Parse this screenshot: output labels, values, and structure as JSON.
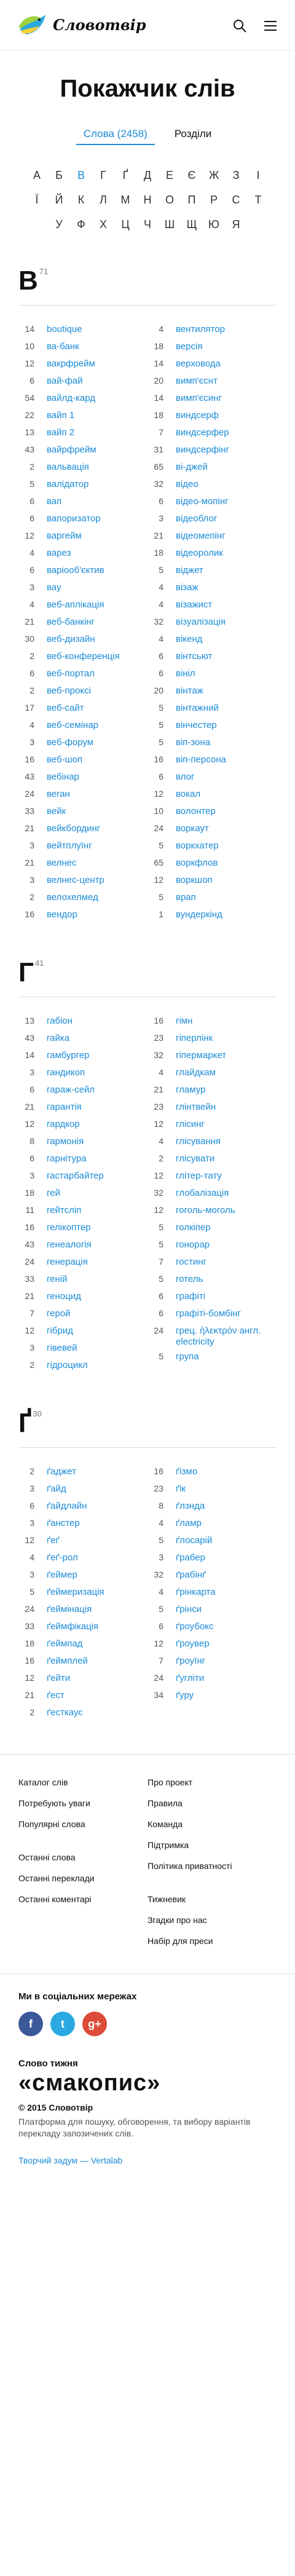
{
  "header": {
    "logo_text": "Словотвір"
  },
  "page_title": "Покажчик слів",
  "tabs": [
    {
      "label": "Слова (2458)",
      "active": true
    },
    {
      "label": "Розділи",
      "active": false
    }
  ],
  "alphabet": [
    "А",
    "Б",
    "В",
    "Г",
    "Ґ",
    "Д",
    "Е",
    "Є",
    "Ж",
    "З",
    "І",
    "Ї",
    "Й",
    "К",
    "Л",
    "М",
    "Н",
    "О",
    "П",
    "Р",
    "С",
    "Т",
    "У",
    "Ф",
    "Х",
    "Ц",
    "Ч",
    "Ш",
    "Щ",
    "Ю",
    "Я"
  ],
  "current_letter": "В",
  "sections": [
    {
      "letter": "В",
      "count": "71",
      "left": [
        {
          "n": "14",
          "w": "boutique"
        },
        {
          "n": "10",
          "w": "ва-банк"
        },
        {
          "n": "12",
          "w": "вакрфрейм"
        },
        {
          "n": "6",
          "w": "вай-фай"
        },
        {
          "n": "54",
          "w": "вайлд-кард"
        },
        {
          "n": "22",
          "w": "вайп 1"
        },
        {
          "n": "13",
          "w": "вайп 2"
        },
        {
          "n": "43",
          "w": "вайрфрейм"
        },
        {
          "n": "2",
          "w": "вальвація"
        },
        {
          "n": "5",
          "w": "валідатор"
        },
        {
          "n": "6",
          "w": "вап"
        },
        {
          "n": "6",
          "w": "вапоризатор"
        },
        {
          "n": "12",
          "w": "варгейм"
        },
        {
          "n": "4",
          "w": "варез"
        },
        {
          "n": "6",
          "w": "варіооб'єктив"
        },
        {
          "n": "3",
          "w": "вау"
        },
        {
          "n": "4",
          "w": "веб-аплікація"
        },
        {
          "n": "21",
          "w": "веб-банкінг"
        },
        {
          "n": "30",
          "w": "веб-дизайн"
        },
        {
          "n": "2",
          "w": "веб-конференція"
        },
        {
          "n": "6",
          "w": "веб-портал"
        },
        {
          "n": "2",
          "w": "веб-проксі"
        },
        {
          "n": "17",
          "w": "веб-сайт"
        },
        {
          "n": "4",
          "w": "веб-семінар"
        },
        {
          "n": "3",
          "w": "веб-форум"
        },
        {
          "n": "16",
          "w": "веб-шоп"
        },
        {
          "n": "43",
          "w": "вебінар"
        },
        {
          "n": "24",
          "w": "веган"
        },
        {
          "n": "33",
          "w": "вейк"
        },
        {
          "n": "21",
          "w": "вейкбординг"
        },
        {
          "n": "3",
          "w": "вейтплуїнг"
        },
        {
          "n": "21",
          "w": "велнес"
        },
        {
          "n": "3",
          "w": "велнес-центр"
        },
        {
          "n": "2",
          "w": "велохелмед"
        },
        {
          "n": "16",
          "w": "вендор"
        }
      ],
      "right": [
        {
          "n": "4",
          "w": "вентилятор"
        },
        {
          "n": "18",
          "w": "версія"
        },
        {
          "n": "14",
          "w": "верховода"
        },
        {
          "n": "20",
          "w": "вимп'єснт"
        },
        {
          "n": "14",
          "w": "вимп'єсинг"
        },
        {
          "n": "18",
          "w": "виндсерф"
        },
        {
          "n": "7",
          "w": "виндсерфер"
        },
        {
          "n": "31",
          "w": "виндсерфінг"
        },
        {
          "n": "65",
          "w": "ві-джей"
        },
        {
          "n": "32",
          "w": "відео"
        },
        {
          "n": "6",
          "w": "відео-мопінг"
        },
        {
          "n": "3",
          "w": "відеоблог"
        },
        {
          "n": "21",
          "w": "відеомепінг"
        },
        {
          "n": "18",
          "w": "відеоролик"
        },
        {
          "n": "5",
          "w": "віджет"
        },
        {
          "n": "4",
          "w": "візаж"
        },
        {
          "n": "4",
          "w": "візажист"
        },
        {
          "n": "32",
          "w": "візуалізація"
        },
        {
          "n": "4",
          "w": "вікенд"
        },
        {
          "n": "6",
          "w": "вінтсьют"
        },
        {
          "n": "6",
          "w": "вініл"
        },
        {
          "n": "20",
          "w": "вінтаж"
        },
        {
          "n": "5",
          "w": "вінтажний"
        },
        {
          "n": "5",
          "w": "вінчестер"
        },
        {
          "n": "5",
          "w": "віп-зона"
        },
        {
          "n": "16",
          "w": "віп-персона"
        },
        {
          "n": "6",
          "w": "влог"
        },
        {
          "n": "12",
          "w": "вокал"
        },
        {
          "n": "10",
          "w": "волонтер"
        },
        {
          "n": "24",
          "w": "воркаут"
        },
        {
          "n": "5",
          "w": "воркхатер"
        },
        {
          "n": "65",
          "w": "воркфлов"
        },
        {
          "n": "12",
          "w": "воркшоп"
        },
        {
          "n": "5",
          "w": "врап"
        },
        {
          "n": "1",
          "w": "вундеркінд"
        }
      ]
    },
    {
      "letter": "Г",
      "count": "41",
      "left": [
        {
          "n": "13",
          "w": "габіон"
        },
        {
          "n": "43",
          "w": "гайка"
        },
        {
          "n": "14",
          "w": "гамбургер"
        },
        {
          "n": "3",
          "w": "гандикоп"
        },
        {
          "n": "6",
          "w": "гараж-сейл"
        },
        {
          "n": "21",
          "w": "гарантія"
        },
        {
          "n": "12",
          "w": "гардкор"
        },
        {
          "n": "8",
          "w": "гармонія"
        },
        {
          "n": "6",
          "w": "гарнітура"
        },
        {
          "n": "3",
          "w": "гастарбайтер"
        },
        {
          "n": "18",
          "w": "гей"
        },
        {
          "n": "11",
          "w": "гейтсліп"
        },
        {
          "n": "16",
          "w": "гелікоптер"
        },
        {
          "n": "43",
          "w": "генеалогія"
        },
        {
          "n": "24",
          "w": "генерація"
        },
        {
          "n": "33",
          "w": "геній"
        },
        {
          "n": "21",
          "w": "геноцид"
        },
        {
          "n": "7",
          "w": "герой"
        },
        {
          "n": "12",
          "w": "гібрид"
        },
        {
          "n": "3",
          "w": "гівевей"
        },
        {
          "n": "2",
          "w": "гідроцикл"
        }
      ],
      "right": [
        {
          "n": "16",
          "w": "гімн"
        },
        {
          "n": "23",
          "w": "гіперлінк"
        },
        {
          "n": "32",
          "w": "гіпермаркет"
        },
        {
          "n": "4",
          "w": "глайдкам"
        },
        {
          "n": "21",
          "w": "гламур"
        },
        {
          "n": "23",
          "w": "глінтвейн"
        },
        {
          "n": "12",
          "w": "глісинг"
        },
        {
          "n": "4",
          "w": "глісування"
        },
        {
          "n": "2",
          "w": "глісувати"
        },
        {
          "n": "12",
          "w": "глітер-тату"
        },
        {
          "n": "32",
          "w": "глобалізація"
        },
        {
          "n": "12",
          "w": "гоголь-моголь"
        },
        {
          "n": "5",
          "w": "голкіпер"
        },
        {
          "n": "5",
          "w": "гонорар"
        },
        {
          "n": "7",
          "w": "гостинг"
        },
        {
          "n": "5",
          "w": "готель"
        },
        {
          "n": "6",
          "w": "графіті"
        },
        {
          "n": "6",
          "w": "графіті-бомбінг"
        },
        {
          "n": "24",
          "w": "грец. ἠλεκτρόν англ. electricity"
        },
        {
          "n": "5",
          "w": "група"
        }
      ]
    },
    {
      "letter": "Ґ",
      "count": "30",
      "left": [
        {
          "n": "2",
          "w": "ґаджет"
        },
        {
          "n": "3",
          "w": "ґайд"
        },
        {
          "n": "6",
          "w": "ґайдлайн"
        },
        {
          "n": "3",
          "w": "ґанстер"
        },
        {
          "n": "12",
          "w": "ґеґ"
        },
        {
          "n": "4",
          "w": "ґеґ-рол"
        },
        {
          "n": "3",
          "w": "ґеймер"
        },
        {
          "n": "5",
          "w": "ґеймеризація"
        },
        {
          "n": "24",
          "w": "ґеймінація"
        },
        {
          "n": "33",
          "w": "ґеймфікація"
        },
        {
          "n": "18",
          "w": "ґеймпад"
        },
        {
          "n": "16",
          "w": "ґеймплей"
        },
        {
          "n": "12",
          "w": "ґейти"
        },
        {
          "n": "21",
          "w": "ґест"
        },
        {
          "n": "2",
          "w": "ґесткаус"
        }
      ],
      "right": [
        {
          "n": "16",
          "w": "ґізмо"
        },
        {
          "n": "23",
          "w": "ґік"
        },
        {
          "n": "8",
          "w": "ґлзнда"
        },
        {
          "n": "4",
          "w": "ґламр"
        },
        {
          "n": "5",
          "w": "ґлосарій"
        },
        {
          "n": "3",
          "w": "ґрабер"
        },
        {
          "n": "32",
          "w": "ґрабінґ"
        },
        {
          "n": "4",
          "w": "ґрінкарта"
        },
        {
          "n": "5",
          "w": "ґрінси"
        },
        {
          "n": "6",
          "w": "ґроубокс"
        },
        {
          "n": "12",
          "w": "ґроувер"
        },
        {
          "n": "7",
          "w": "ґроуїнг"
        },
        {
          "n": "24",
          "w": "ґугліти"
        },
        {
          "n": "34",
          "w": "ґуру"
        }
      ]
    }
  ],
  "footer": {
    "col1_top": [
      "Каталог слів",
      "Потребують уваги",
      "Популярні слова"
    ],
    "col1_bottom": [
      "Останні слова",
      "Останні переклади",
      "Останні коментарі"
    ],
    "col2_top": [
      "Про проект",
      "Правила",
      "Команда",
      "Підтримка",
      "Політика приватності"
    ],
    "col2_bottom": [
      "Тижневик",
      "Згадки про нас",
      "Набір для преси"
    ]
  },
  "social": {
    "title": "Ми в соціальних мережах",
    "facebook": "f",
    "twitter": "t",
    "googleplus": "g+"
  },
  "brand": {
    "slogan_small": "Слово тижня",
    "slogan_big": "«смакопис»",
    "copyright": "© 2015 Словотвір",
    "description": "Платформа для пошуку, обговорення, та вибору варіантів перекладу запозичених слів.",
    "credit": "Творчий задум — Vertalab"
  },
  "colors": {
    "accent": "#1a8bd8",
    "text": "#111111",
    "muted": "#555555"
  }
}
